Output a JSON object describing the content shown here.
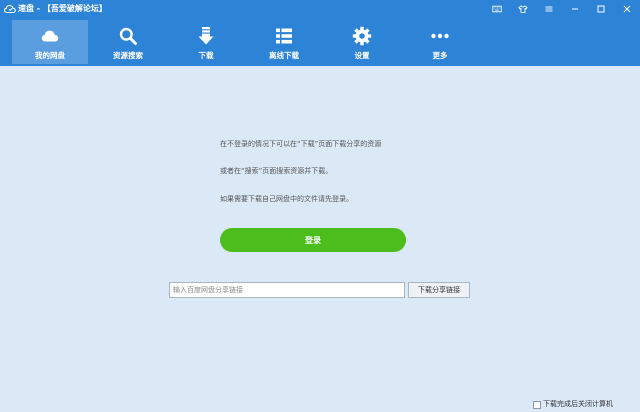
{
  "window": {
    "title": "速盘 - 【吾爱破解论坛】"
  },
  "titlebar_buttons": [
    {
      "name": "keyboard-icon"
    },
    {
      "name": "skin-icon"
    },
    {
      "name": "menu-icon"
    },
    {
      "name": "minimize-icon"
    },
    {
      "name": "maximize-icon"
    },
    {
      "name": "close-icon"
    }
  ],
  "nav": {
    "items": [
      {
        "label": "我的网盘",
        "icon": "cloud-icon",
        "active": true
      },
      {
        "label": "资源搜索",
        "icon": "search-icon",
        "active": false
      },
      {
        "label": "下载",
        "icon": "download-icon",
        "active": false
      },
      {
        "label": "离线下载",
        "icon": "list-icon",
        "active": false
      },
      {
        "label": "设置",
        "icon": "gear-icon",
        "active": false
      },
      {
        "label": "更多",
        "icon": "more-icon",
        "active": false
      }
    ]
  },
  "main": {
    "info_lines": [
      "在不登录的情况下可以在“下载”页面下载分享的资源",
      "或者在“搜索”页面搜索资源并下载。",
      "如果需要下载自己网盘中的文件请先登录。"
    ],
    "login_label": "登录",
    "share_input_placeholder": "输入百度网盘分享链接",
    "share_input_value": "",
    "share_button_label": "下载分享链接"
  },
  "footer": {
    "shutdown_label": "下载完成后关闭计算机",
    "shutdown_checked": false
  },
  "colors": {
    "header": "#2d83d6",
    "background": "#dbe9f7",
    "login_button": "#4dbd1e"
  }
}
